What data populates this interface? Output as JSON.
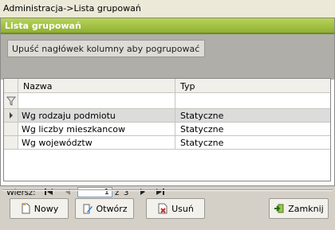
{
  "window": {
    "breadcrumb": "Administracja->Lista grupowań"
  },
  "panel": {
    "title": "Lista grupowań",
    "group_hint": "Upuść nagłówek kolumny aby pogrupować"
  },
  "grid": {
    "columns": [
      "Nazwa",
      "Typ"
    ],
    "rows": [
      {
        "name": "Wg rodzaju podmiotu",
        "type": "Statyczne"
      },
      {
        "name": "Wg liczby mieszkancow",
        "type": "Statyczne"
      },
      {
        "name": "Wg województw",
        "type": "Statyczne"
      }
    ]
  },
  "pager": {
    "label": "Wiersz:",
    "current": "1",
    "of": "z",
    "total": "3",
    "icons": [
      "first-page-icon",
      "prev-page-icon",
      "next-page-icon",
      "last-page-icon"
    ]
  },
  "buttons": {
    "new": {
      "label": "Nowy",
      "icon": "new-document-icon"
    },
    "open": {
      "label": "Otwórz",
      "icon": "edit-icon"
    },
    "delete": {
      "label": "Usuń",
      "icon": "delete-icon"
    },
    "close": {
      "label": "Zamknij",
      "icon": "exit-icon"
    }
  },
  "colors": {
    "header_green": "#a5c446",
    "accent_border": "#6f8c1f",
    "delete_red": "#cc2a2a"
  }
}
